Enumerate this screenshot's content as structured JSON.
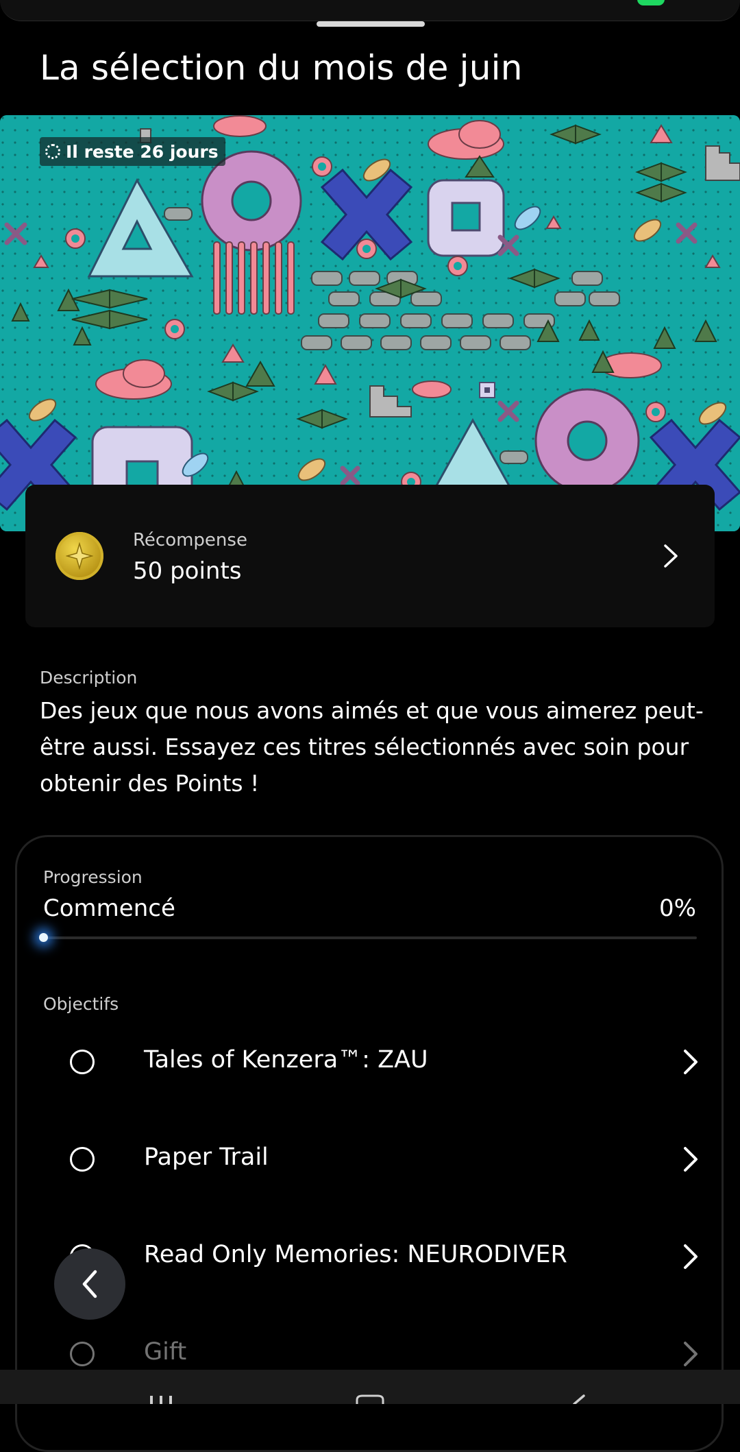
{
  "page": {
    "title": "La sélection du mois de juin"
  },
  "banner": {
    "badge_text": "Il reste 26 jours",
    "colors": {
      "background": "#13a8a4",
      "pink": "#f28a96",
      "lilac": "#d9d3ee",
      "blue": "#3b4bb8",
      "purple": "#c98fc7",
      "green": "#4f7a4a"
    }
  },
  "reward": {
    "label": "Récompense",
    "value": "50 points",
    "icon": "coin-icon"
  },
  "description": {
    "label": "Description",
    "text": "Des jeux que nous avons aimés et que vous aimerez peut-être aussi. Essayez ces titres sélectionnés avec soin pour obtenir des Points !"
  },
  "progress": {
    "label": "Progression",
    "status": "Commencé",
    "percent_label": "0%",
    "percent": 0,
    "accent": "#3aa3ff"
  },
  "objectives": {
    "label": "Objectifs",
    "items": [
      {
        "title": "Tales of Kenzera™: ZAU"
      },
      {
        "title": "Paper Trail"
      },
      {
        "title": "Read Only Memories: NEURODIVER"
      },
      {
        "title": "Gift"
      }
    ]
  },
  "icons": {
    "back": "chevron-left-icon",
    "row": "chevron-right-icon",
    "nav": [
      "recent-apps-icon",
      "home-icon",
      "back-icon"
    ]
  }
}
